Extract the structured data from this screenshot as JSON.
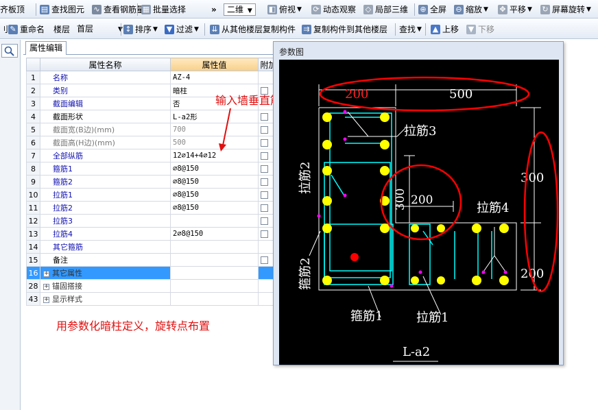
{
  "toolbar1": {
    "items": [
      {
        "label": "齐板顶"
      },
      {
        "label": "查找图元"
      },
      {
        "label": "查看钢筋量"
      },
      {
        "label": "批量选择"
      },
      {
        "label": "»"
      },
      {
        "label": "二维"
      },
      {
        "label": "俯视"
      },
      {
        "label": "动态观察"
      },
      {
        "label": "局部三维"
      },
      {
        "label": "全屏"
      },
      {
        "label": "缩放"
      },
      {
        "label": "平移"
      },
      {
        "label": "屏幕旋转"
      }
    ]
  },
  "toolbar2": {
    "rename": "重命名",
    "floor_label": "楼层",
    "floor_value": "首层",
    "sort": "排序",
    "filter": "过滤",
    "copy_from": "从其他楼层复制构件",
    "copy_to": "复制构件到其他楼层",
    "find": "查找",
    "move_up": "上移",
    "move_down": "下移"
  },
  "panel": {
    "tab": "属性编辑",
    "col_name": "属性名称",
    "col_value": "属性值",
    "col_extra": "附加"
  },
  "rows": [
    {
      "num": "1",
      "name": "名称",
      "value": "AZ-4",
      "check": false
    },
    {
      "num": "2",
      "name": "类别",
      "value": "暗柱",
      "check": true
    },
    {
      "num": "3",
      "name": "截面编辑",
      "value": "否",
      "check": false
    },
    {
      "num": "4",
      "name": "截面形状",
      "value": "L-a2形",
      "check": true
    },
    {
      "num": "5",
      "name": "截面宽(B边)(mm)",
      "value": "700",
      "check": true
    },
    {
      "num": "6",
      "name": "截面高(H边)(mm)",
      "value": "500",
      "check": true
    },
    {
      "num": "7",
      "name": "全部纵筋",
      "value": "12⌀14+4⌀12",
      "check": true
    },
    {
      "num": "8",
      "name": "箍筋1",
      "value": "⌀8@150",
      "check": true
    },
    {
      "num": "9",
      "name": "箍筋2",
      "value": "⌀8@150",
      "check": true
    },
    {
      "num": "10",
      "name": "拉筋1",
      "value": "⌀8@150",
      "check": true
    },
    {
      "num": "11",
      "name": "拉筋2",
      "value": "⌀8@150",
      "check": true
    },
    {
      "num": "12",
      "name": "拉筋3",
      "value": "",
      "check": true
    },
    {
      "num": "13",
      "name": "拉筋4",
      "value": "2⌀8@150",
      "check": true
    },
    {
      "num": "14",
      "name": "其它箍筋",
      "value": "",
      "check": false
    },
    {
      "num": "15",
      "name": "备注",
      "value": "",
      "check": true
    },
    {
      "num": "16",
      "name": "其它属性",
      "value": "",
      "check": false
    },
    {
      "num": "28",
      "name": "锚固搭接",
      "value": "",
      "check": false
    },
    {
      "num": "43",
      "name": "显示样式",
      "value": "",
      "check": false
    }
  ],
  "annotations": {
    "input_hint": "输入墙垂直筋规格",
    "bottom_hint": "用参数化暗柱定义，旋转点布置"
  },
  "dialog": {
    "title": "参数图",
    "dims": {
      "top_left": "200",
      "top_right": "500",
      "right_top": "300",
      "right_bottom": "200",
      "inner_v": "300",
      "inner_h": "200"
    },
    "labels": {
      "la3": "拉筋3",
      "la2": "拉筋2",
      "la4": "拉筋4",
      "gu2": "箍筋2",
      "gu1": "箍筋1",
      "la1": "拉筋1",
      "shape": "L-a2"
    }
  },
  "colors": {
    "accent": "#3399ff",
    "annotation": "#e01010",
    "rebar": "#ffff00",
    "stirrup": "#00ffff"
  }
}
